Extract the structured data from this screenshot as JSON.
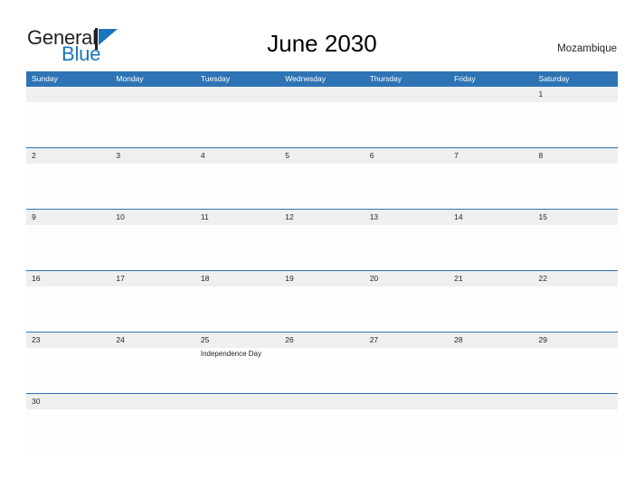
{
  "brand": {
    "name_part1": "General",
    "name_part2": "Blue",
    "flag_color": "#1b75bb",
    "text_color": "#231f20"
  },
  "header": {
    "title": "June 2030",
    "country": "Mozambique"
  },
  "theme": {
    "header_blue": "#2e74b5",
    "date_band_gray": "#efefef",
    "cell_white": "#fdfdfd",
    "text_dark": "#231f20"
  },
  "calendar": {
    "weekdays": [
      "Sunday",
      "Monday",
      "Tuesday",
      "Wednesday",
      "Thursday",
      "Friday",
      "Saturday"
    ],
    "weeks": [
      {
        "days": [
          {
            "date": "",
            "event": ""
          },
          {
            "date": "",
            "event": ""
          },
          {
            "date": "",
            "event": ""
          },
          {
            "date": "",
            "event": ""
          },
          {
            "date": "",
            "event": ""
          },
          {
            "date": "",
            "event": ""
          },
          {
            "date": "1",
            "event": ""
          }
        ]
      },
      {
        "days": [
          {
            "date": "2",
            "event": ""
          },
          {
            "date": "3",
            "event": ""
          },
          {
            "date": "4",
            "event": ""
          },
          {
            "date": "5",
            "event": ""
          },
          {
            "date": "6",
            "event": ""
          },
          {
            "date": "7",
            "event": ""
          },
          {
            "date": "8",
            "event": ""
          }
        ]
      },
      {
        "days": [
          {
            "date": "9",
            "event": ""
          },
          {
            "date": "10",
            "event": ""
          },
          {
            "date": "11",
            "event": ""
          },
          {
            "date": "12",
            "event": ""
          },
          {
            "date": "13",
            "event": ""
          },
          {
            "date": "14",
            "event": ""
          },
          {
            "date": "15",
            "event": ""
          }
        ]
      },
      {
        "days": [
          {
            "date": "16",
            "event": ""
          },
          {
            "date": "17",
            "event": ""
          },
          {
            "date": "18",
            "event": ""
          },
          {
            "date": "19",
            "event": ""
          },
          {
            "date": "20",
            "event": ""
          },
          {
            "date": "21",
            "event": ""
          },
          {
            "date": "22",
            "event": ""
          }
        ]
      },
      {
        "days": [
          {
            "date": "23",
            "event": ""
          },
          {
            "date": "24",
            "event": ""
          },
          {
            "date": "25",
            "event": "Independence Day"
          },
          {
            "date": "26",
            "event": ""
          },
          {
            "date": "27",
            "event": ""
          },
          {
            "date": "28",
            "event": ""
          },
          {
            "date": "29",
            "event": ""
          }
        ]
      },
      {
        "days": [
          {
            "date": "30",
            "event": ""
          },
          {
            "date": "",
            "event": ""
          },
          {
            "date": "",
            "event": ""
          },
          {
            "date": "",
            "event": ""
          },
          {
            "date": "",
            "event": ""
          },
          {
            "date": "",
            "event": ""
          },
          {
            "date": "",
            "event": ""
          }
        ]
      }
    ]
  }
}
